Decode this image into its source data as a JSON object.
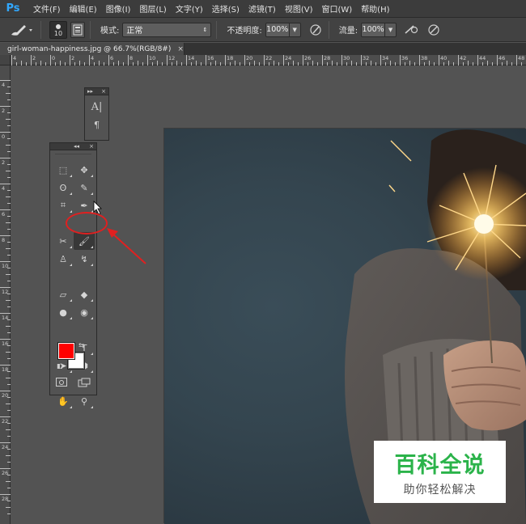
{
  "app": {
    "logo": "Ps"
  },
  "menu": {
    "items": [
      "文件(F)",
      "编辑(E)",
      "图像(I)",
      "图层(L)",
      "文字(Y)",
      "选择(S)",
      "滤镜(T)",
      "视图(V)",
      "窗口(W)",
      "帮助(H)"
    ]
  },
  "options": {
    "brush_size": "10",
    "mode_label": "模式:",
    "mode_value": "正常",
    "opacity_label": "不透明度:",
    "opacity_value": "100%",
    "flow_label": "流量:",
    "flow_value": "100%"
  },
  "document": {
    "tab_title": "girl-woman-happiness.jpg @ 66.7%(RGB/8#)",
    "tab_close": "×"
  },
  "rulers": {
    "top": [
      "4",
      "2",
      "0",
      "2",
      "4",
      "6",
      "8",
      "10",
      "12",
      "14",
      "16",
      "18",
      "20",
      "22",
      "24",
      "26",
      "28",
      "30",
      "32",
      "34",
      "36",
      "38",
      "40",
      "42",
      "44",
      "46",
      "48"
    ],
    "left": [
      "4",
      "2",
      "0",
      "2",
      "4",
      "6",
      "8",
      "10",
      "12",
      "14",
      "16",
      "18",
      "20",
      "22",
      "24",
      "26",
      "28"
    ]
  },
  "panels": {
    "mini": {
      "expand": "▸▸",
      "close": "×",
      "char_glyph": "A|",
      "para_glyph": "¶"
    },
    "toolbox": {
      "collapse": "◂◂",
      "close": "×"
    }
  },
  "colors": {
    "foreground": "#ff0000",
    "background": "#ffffff",
    "annotation": "#e02020",
    "watermark_green": "#2bb34a"
  },
  "tools": [
    {
      "name": "rect-marquee-icon",
      "glyph": "⬚"
    },
    {
      "name": "move-icon",
      "glyph": "✥"
    },
    {
      "name": "lasso-icon",
      "glyph": "ʘ"
    },
    {
      "name": "quick-select-icon",
      "glyph": "✎"
    },
    {
      "name": "crop-icon",
      "glyph": "⌗"
    },
    {
      "name": "eyedropper-icon",
      "glyph": "✒"
    },
    {
      "name": "healing-icon",
      "glyph": "✂"
    },
    {
      "name": "brush-icon",
      "glyph": "🖌"
    },
    {
      "name": "stamp-icon",
      "glyph": "♙"
    },
    {
      "name": "history-brush-icon",
      "glyph": "↯"
    },
    {
      "name": "eraser-icon",
      "glyph": "▱"
    },
    {
      "name": "paint-bucket-icon",
      "glyph": "◆"
    },
    {
      "name": "blur-icon",
      "glyph": "●"
    },
    {
      "name": "dodge-icon",
      "glyph": "◉"
    },
    {
      "name": "pen-icon",
      "glyph": "✑"
    },
    {
      "name": "type-icon",
      "glyph": "T"
    },
    {
      "name": "path-select-icon",
      "glyph": "➤"
    },
    {
      "name": "shape-icon",
      "glyph": "⬢"
    },
    {
      "name": "hand-icon",
      "glyph": "✋"
    },
    {
      "name": "zoom-icon",
      "glyph": "⚲"
    }
  ],
  "watermark": {
    "title": "百科全说",
    "subtitle": "助你轻松解决"
  }
}
